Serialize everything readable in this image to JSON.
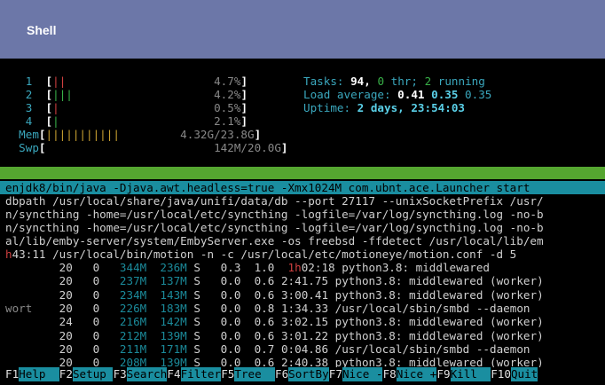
{
  "header": {
    "title": "Shell"
  },
  "meters": {
    "cpu1": {
      "num": "1",
      "bar": "||",
      "pct": "4.7%"
    },
    "cpu2": {
      "num": "2",
      "bar": "|||",
      "pct": "4.2%"
    },
    "cpu3": {
      "num": "3",
      "bar": "|",
      "pct": "0.5%"
    },
    "cpu4": {
      "num": "4",
      "bar": "|",
      "pct": "2.1%"
    },
    "mem": {
      "label": "Mem",
      "bar": "|||||||||||",
      "val": "4.32G/23.8G"
    },
    "swp": {
      "label": "Swp",
      "bar": "",
      "val": "142M/20.0G"
    }
  },
  "summary": {
    "tasks_label": "Tasks:",
    "tasks": "94,",
    "thr": "0",
    "thr_label": "thr;",
    "running": "2",
    "running_label": "running",
    "load_label": "Load average:",
    "load1": "0.41",
    "load5": "0.35",
    "load15": "0.35",
    "uptime_label": "Uptime:",
    "uptime": "2 days, 23:54:03"
  },
  "cmdlines": {
    "selected": "enjdk8/bin/java -Djava.awt.headless=true -Xmx1024M com.ubnt.ace.Launcher start",
    "l1": "dbpath /usr/local/share/java/unifi/data/db --port 27117 --unixSocketPrefix /usr/",
    "l2": "n/syncthing -home=/usr/local/etc/syncthing -logfile=/var/log/syncthing.log -no-b",
    "l3": "n/syncthing -home=/usr/local/etc/syncthing -logfile=/var/log/syncthing.log -no-b",
    "l4": "al/lib/emby-server/system/EmbyServer.exe -os freebsd -ffdetect /usr/local/lib/em",
    "l5a": "h",
    "l5b": "43:11 /usr/local/bin/motion -n -c /usr/local/etc/motioneye/motion.conf -d 5"
  },
  "processes": [
    {
      "user": "",
      "pri": "20",
      "ni": "0",
      "virt": "344M",
      "res": "236M",
      "s": "S",
      "cpu": "0.3",
      "mem": "1.0",
      "time_h": "1h",
      "time": "02:18",
      "cmd": "python3.8: middlewared"
    },
    {
      "user": "",
      "pri": "20",
      "ni": "0",
      "virt": "237M",
      "res": "137M",
      "s": "S",
      "cpu": "0.0",
      "mem": "0.6",
      "time_h": "",
      "time": "2:41.75",
      "cmd": "python3.8: middlewared (worker)"
    },
    {
      "user": "",
      "pri": "20",
      "ni": "0",
      "virt": "234M",
      "res": "143M",
      "s": "S",
      "cpu": "0.0",
      "mem": "0.6",
      "time_h": "",
      "time": "3:00.41",
      "cmd": "python3.8: middlewared (worker)"
    },
    {
      "user": "wort",
      "pri": "20",
      "ni": "0",
      "virt": "226M",
      "res": "183M",
      "s": "S",
      "cpu": "0.0",
      "mem": "0.8",
      "time_h": "",
      "time": "1:34.33",
      "cmd": "/usr/local/sbin/smbd --daemon"
    },
    {
      "user": "",
      "pri": "24",
      "ni": "0",
      "virt": "216M",
      "res": "142M",
      "s": "S",
      "cpu": "0.0",
      "mem": "0.6",
      "time_h": "",
      "time": "3:02.15",
      "cmd": "python3.8: middlewared (worker)"
    },
    {
      "user": "",
      "pri": "20",
      "ni": "0",
      "virt": "212M",
      "res": "139M",
      "s": "S",
      "cpu": "0.0",
      "mem": "0.6",
      "time_h": "",
      "time": "3:01.22",
      "cmd": "python3.8: middlewared (worker)"
    },
    {
      "user": "",
      "pri": "20",
      "ni": "0",
      "virt": "211M",
      "res": "171M",
      "s": "S",
      "cpu": "0.0",
      "mem": "0.7",
      "time_h": "",
      "time": "0:04.86",
      "cmd": "/usr/local/sbin/smbd --daemon"
    },
    {
      "user": "",
      "pri": "20",
      "ni": "0",
      "virt": "208M",
      "res": "139M",
      "s": "S",
      "cpu": "0.0",
      "mem": "0.6",
      "time_h": "",
      "time": "2:40.38",
      "cmd": "python3.8: middlewared (worker)"
    }
  ],
  "fkeys": [
    {
      "key": "F1",
      "label": "Help  "
    },
    {
      "key": "F2",
      "label": "Setup "
    },
    {
      "key": "F3",
      "label": "Search"
    },
    {
      "key": "F4",
      "label": "Filter"
    },
    {
      "key": "F5",
      "label": "Tree  "
    },
    {
      "key": "F6",
      "label": "SortBy"
    },
    {
      "key": "F7",
      "label": "Nice -"
    },
    {
      "key": "F8",
      "label": "Nice +"
    },
    {
      "key": "F9",
      "label": "Kill  "
    },
    {
      "key": "F10",
      "label": "Quit"
    }
  ],
  "colors": {
    "header_bg": "#6c77a8",
    "selection_bg": "#1a8ea0",
    "header_bar": "#55a630"
  }
}
